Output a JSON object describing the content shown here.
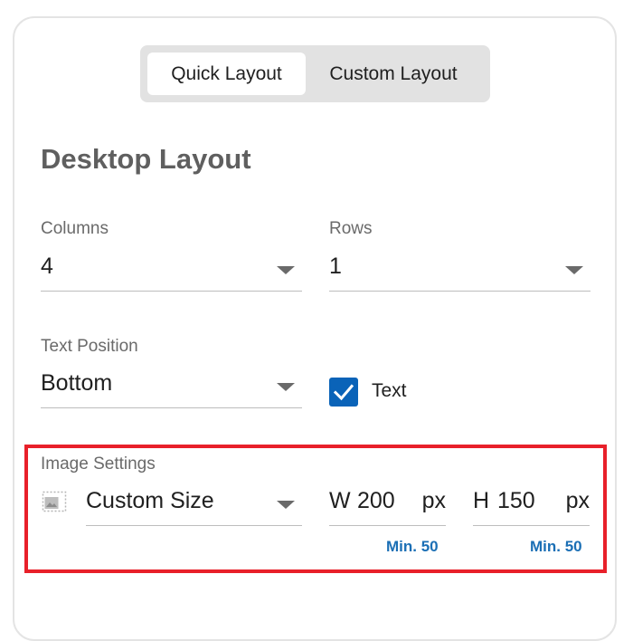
{
  "layout_toggle": {
    "options": [
      {
        "label": "Quick Layout",
        "selected": true
      },
      {
        "label": "Custom Layout",
        "selected": false
      }
    ]
  },
  "section_title": "Desktop Layout",
  "columns": {
    "label": "Columns",
    "value": "4"
  },
  "rows": {
    "label": "Rows",
    "value": "1"
  },
  "text_position": {
    "label": "Text Position",
    "value": "Bottom"
  },
  "text_checkbox": {
    "label": "Text",
    "checked": true
  },
  "image_settings": {
    "label": "Image Settings",
    "size_value": "Custom Size",
    "width": {
      "prefix": "W",
      "value": "200",
      "unit": "px",
      "hint": "Min. 50"
    },
    "height": {
      "prefix": "H",
      "value": "150",
      "unit": "px",
      "hint": "Min. 50"
    }
  },
  "colors": {
    "accent": "#0a63b8",
    "hint": "#1b6fb5",
    "highlight": "#e8202a"
  }
}
